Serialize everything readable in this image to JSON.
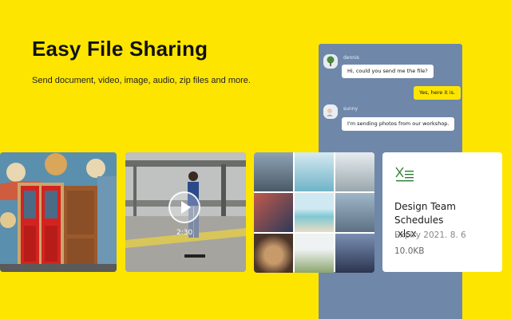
{
  "hero": {
    "title": "Easy File Sharing",
    "subtitle": "Send document, video, image, audio, zip files and more."
  },
  "chat": {
    "messages": [
      {
        "sender": "dennis",
        "text": "Hi, could you send me the file?",
        "direction": "in"
      },
      {
        "text": "Yes, here it is.",
        "direction": "out"
      },
      {
        "sender": "sunny",
        "text": "I'm sending photos from our workshop.",
        "direction": "in"
      }
    ]
  },
  "video": {
    "duration": "2:30"
  },
  "file": {
    "icon": "excel-file-icon",
    "name_line1": "Design Team Schedules",
    "name_line2": ".xlsx",
    "expiry": "Expiry 2021. 8. 6",
    "size": "10.0KB"
  },
  "colors": {
    "background": "#fee500",
    "chat_panel": "#6f87a9",
    "bubble_out": "#fee500",
    "bubble_in": "#ffffff",
    "file_icon": "#2e7d32"
  }
}
